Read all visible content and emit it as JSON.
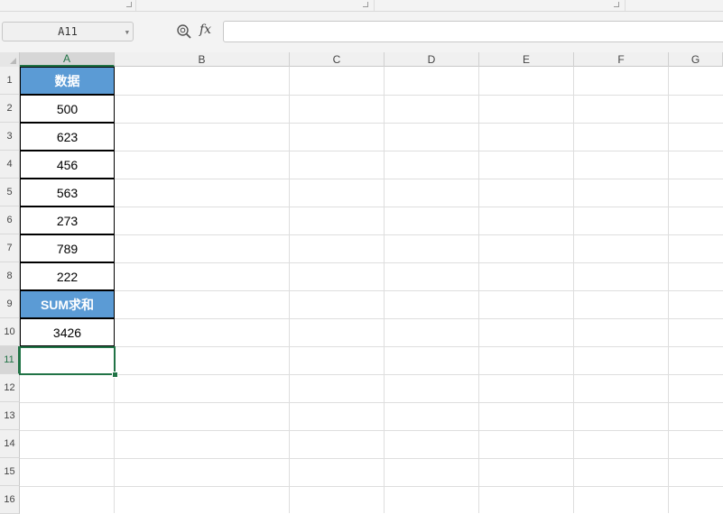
{
  "name_box": {
    "value": "A11"
  },
  "formula": {
    "fx_label": "fx",
    "value": ""
  },
  "columns": [
    "A",
    "B",
    "C",
    "D",
    "E",
    "F",
    "G"
  ],
  "rows": [
    "1",
    "2",
    "3",
    "4",
    "5",
    "6",
    "7",
    "8",
    "9",
    "10",
    "11",
    "12",
    "13",
    "14",
    "15",
    "16"
  ],
  "cells": {
    "a1": "数据",
    "a2": "500",
    "a3": "623",
    "a4": "456",
    "a5": "563",
    "a6": "273",
    "a7": "789",
    "a8": "222",
    "a9": "SUM求和",
    "a10": "3426",
    "a11": ""
  },
  "colors": {
    "header_fill": "#5b9bd5",
    "selection": "#217346"
  },
  "icons": {
    "zoom": "zoom-icon",
    "fx": "function-icon"
  }
}
